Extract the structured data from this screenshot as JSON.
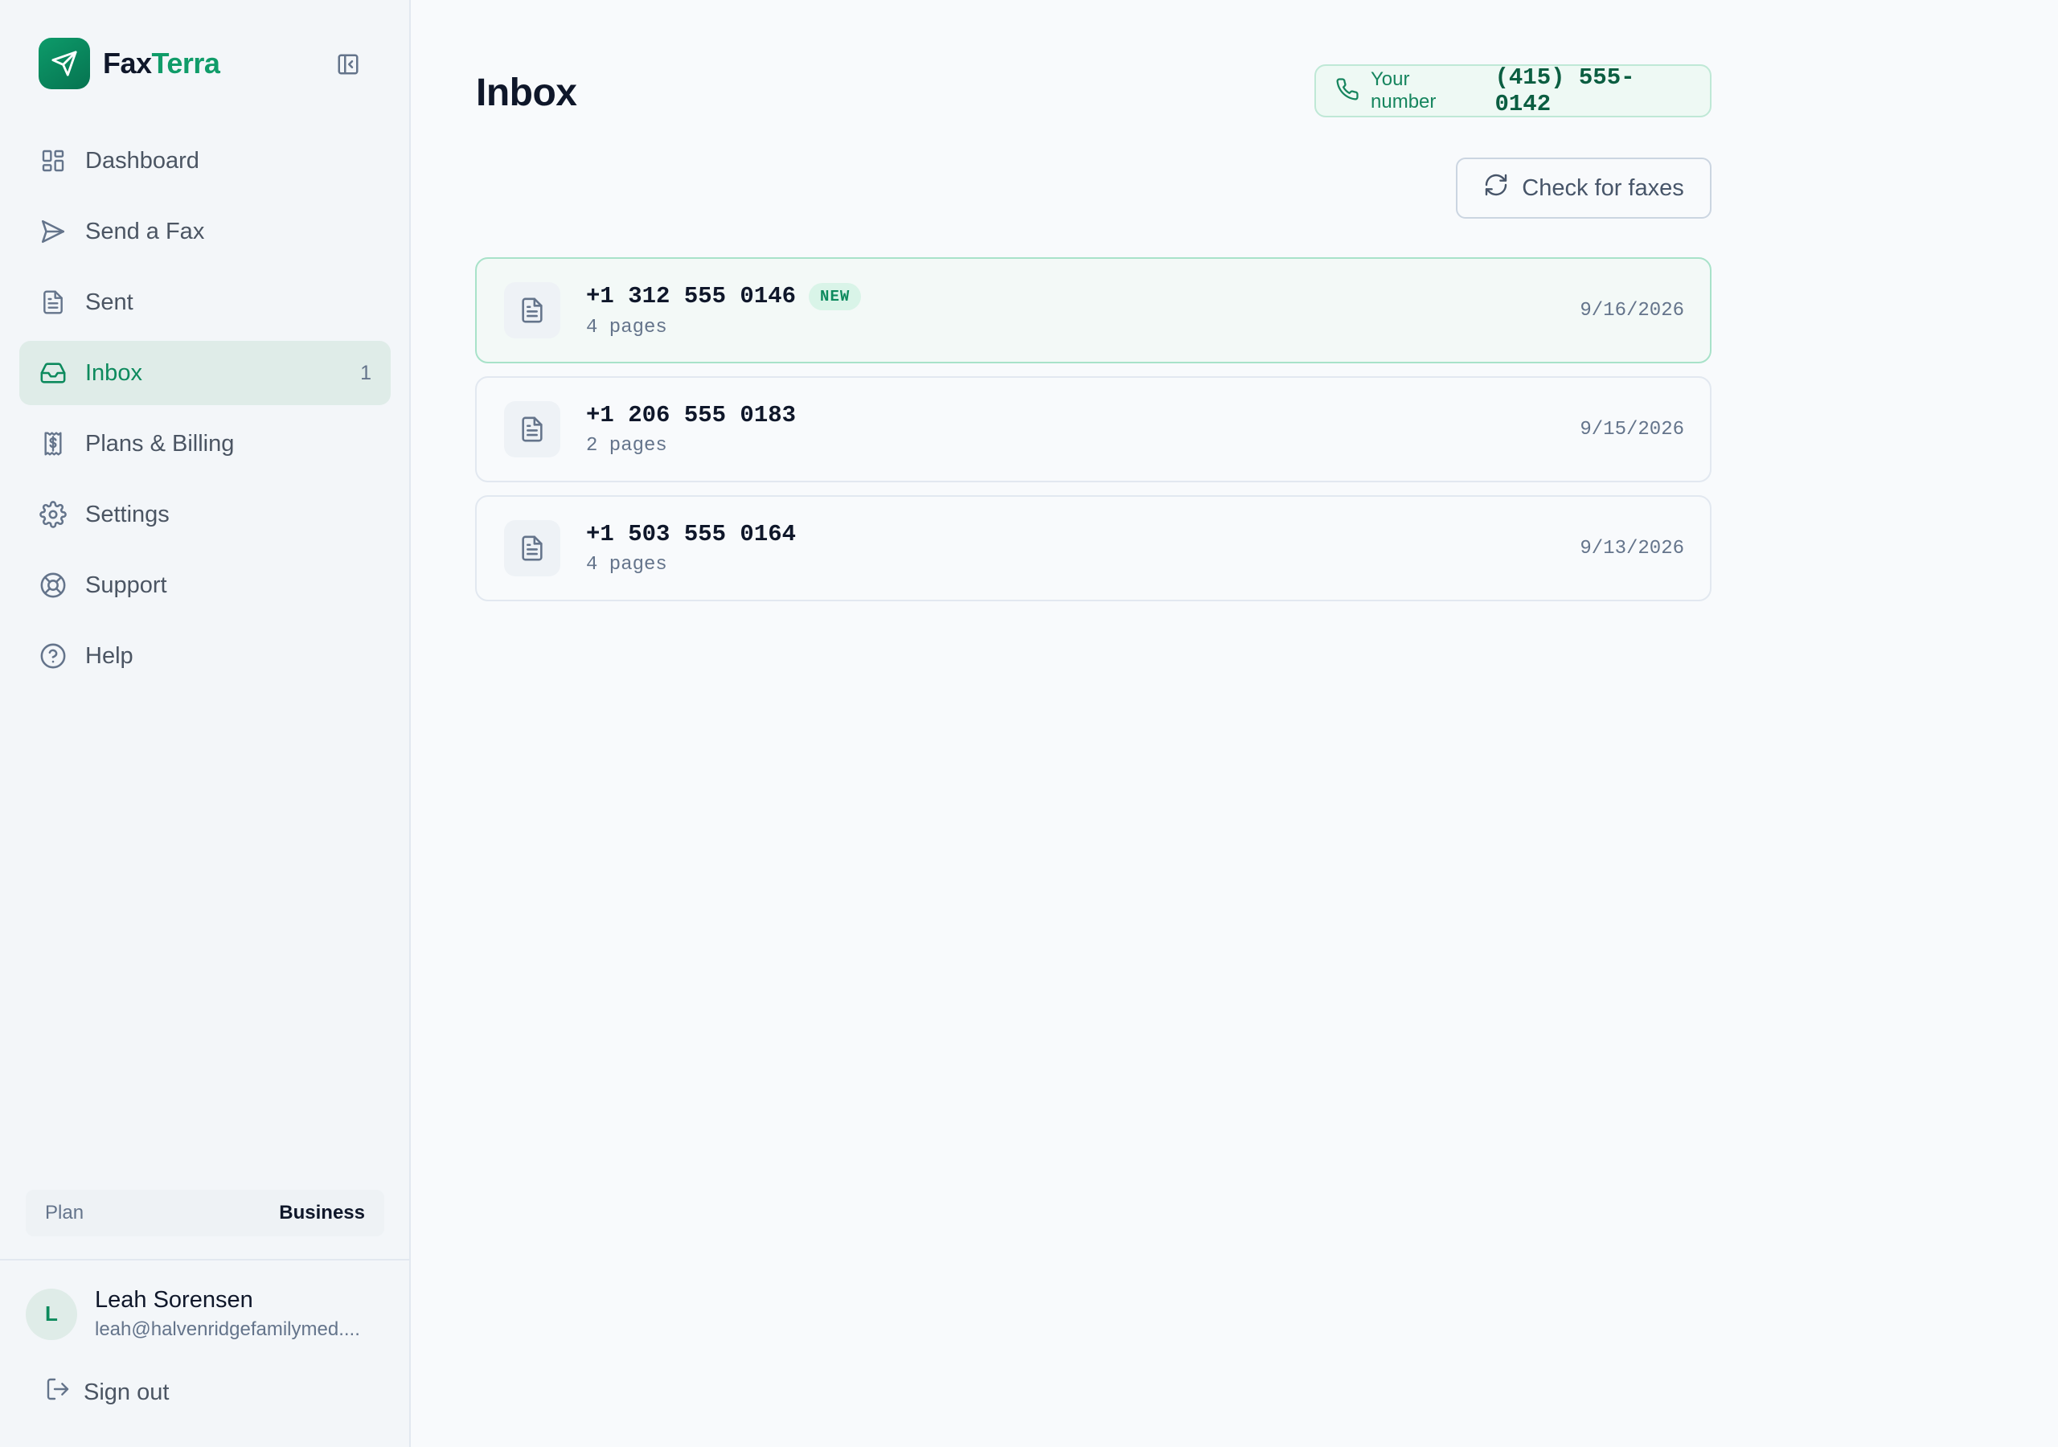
{
  "brand": {
    "name_part1": "Fax",
    "name_part2": "Terra"
  },
  "sidebar": {
    "items": [
      {
        "label": "Dashboard",
        "icon": "dashboard-icon"
      },
      {
        "label": "Send a Fax",
        "icon": "send-icon"
      },
      {
        "label": "Sent",
        "icon": "document-icon"
      },
      {
        "label": "Inbox",
        "icon": "inbox-icon",
        "count": "1",
        "active": true
      },
      {
        "label": "Plans & Billing",
        "icon": "receipt-icon"
      },
      {
        "label": "Settings",
        "icon": "gear-icon"
      },
      {
        "label": "Support",
        "icon": "lifebuoy-icon"
      },
      {
        "label": "Help",
        "icon": "help-circle-icon"
      }
    ],
    "plan": {
      "label": "Plan",
      "value": "Business"
    },
    "user": {
      "initial": "L",
      "name": "Leah Sorensen",
      "email": "leah@halvenridgefamilymed...."
    },
    "signout_label": "Sign out"
  },
  "main": {
    "title": "Inbox",
    "number_label": "Your number",
    "number_value": "(415) 555-0142",
    "check_button_label": "Check for faxes",
    "faxes": [
      {
        "number": "+1 312 555 0146",
        "pages": "4 pages",
        "date": "9/16/2026",
        "badge": "NEW"
      },
      {
        "number": "+1 206 555 0183",
        "pages": "2 pages",
        "date": "9/15/2026"
      },
      {
        "number": "+1 503 555 0164",
        "pages": "4 pages",
        "date": "9/13/2026"
      }
    ]
  },
  "colors": {
    "accent": "#109c69",
    "active_bg": "#dfece8",
    "new_border": "#a8e2c9"
  }
}
